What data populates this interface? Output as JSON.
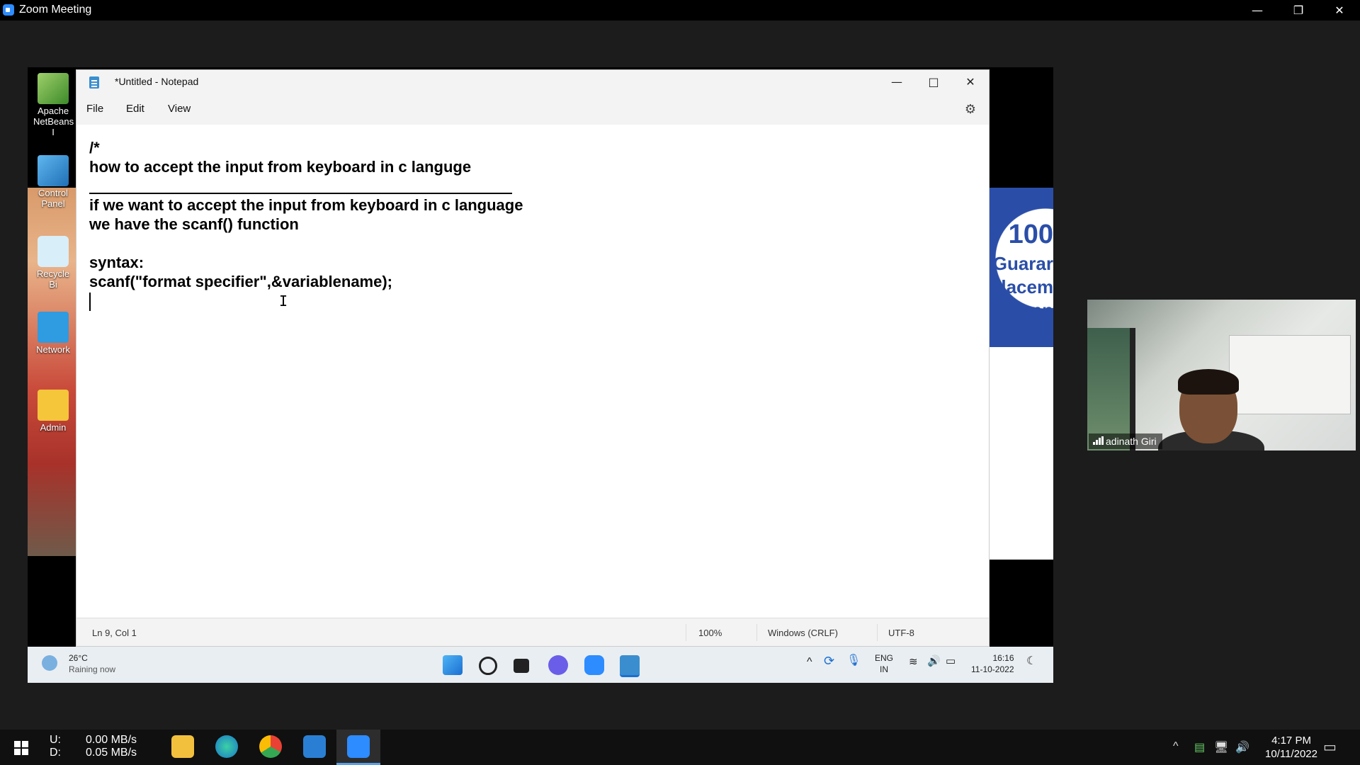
{
  "zoom": {
    "title": "Zoom Meeting"
  },
  "window_controls": {
    "minimize": "—",
    "restore": "❐",
    "close": "✕"
  },
  "desktop": {
    "icons": [
      {
        "label": "Apache NetBeans I"
      },
      {
        "label": "Control Panel"
      },
      {
        "label": "Recycle Bi"
      },
      {
        "label": "Network"
      },
      {
        "label": "Admin"
      }
    ]
  },
  "banner": {
    "lines": [
      "100",
      "Guarar",
      "Placem",
      "Supp"
    ]
  },
  "notepad": {
    "title": "*Untitled - Notepad",
    "menu": {
      "file": "File",
      "edit": "Edit",
      "view": "View"
    },
    "lines": [
      "/*",
      "how to accept the input from keyboard in c languge",
      "if we want to accept the input from keyboard in c language",
      "we have the scanf() function",
      "syntax:",
      "scanf(\"format specifier\",&variablename);"
    ],
    "status": {
      "position": "Ln 9, Col 1",
      "zoom": "100%",
      "line_ending": "Windows (CRLF)",
      "encoding": "UTF-8"
    }
  },
  "inner_taskbar": {
    "weather": {
      "temp": "26°C",
      "desc": "Raining now"
    },
    "lang": {
      "top": "ENG",
      "bottom": "IN"
    },
    "time": "16:16",
    "date": "11-10-2022"
  },
  "video": {
    "participant": "adinath Giri"
  },
  "host_taskbar": {
    "upload_label": "U:",
    "download_label": "D:",
    "upload_speed": "0.00 MB/s",
    "download_speed": "0.05 MB/s",
    "time": "4:17 PM",
    "date": "10/11/2022"
  },
  "colors": {
    "notepad_accent": "#3a8ecf",
    "zoom_blue": "#2d8cff",
    "taskbar_active": "#5aa0e6"
  }
}
